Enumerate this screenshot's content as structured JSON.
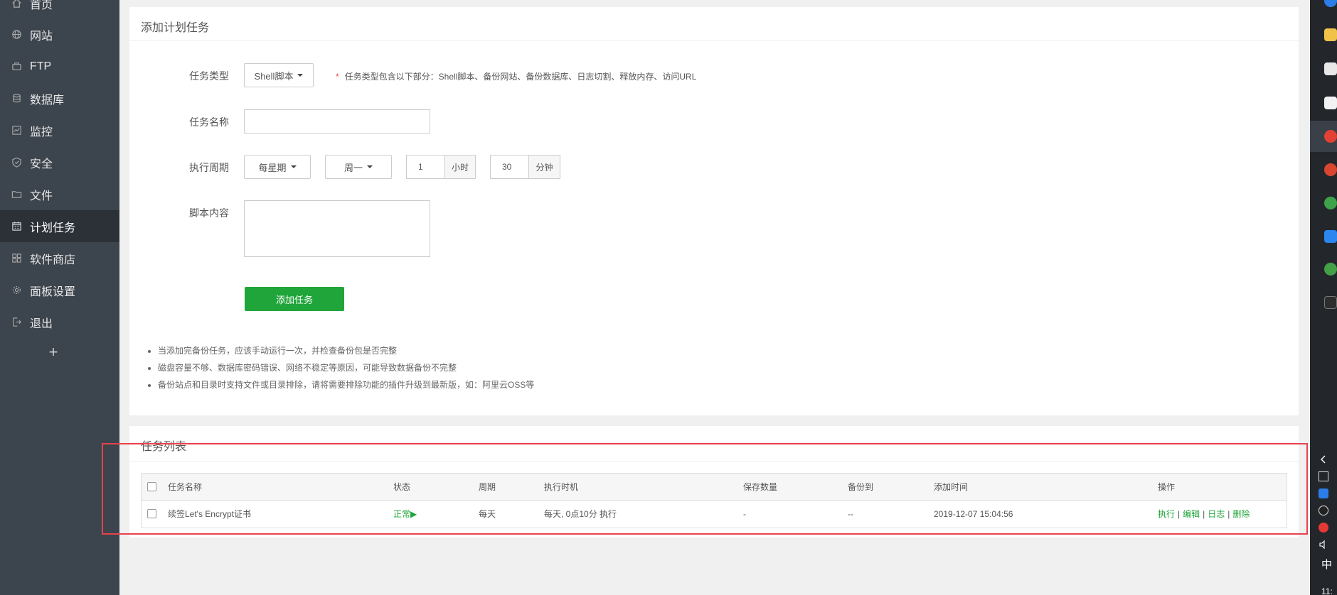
{
  "sidebar": {
    "items": [
      {
        "label": "首页",
        "icon": "home-icon"
      },
      {
        "label": "网站",
        "icon": "globe-icon"
      },
      {
        "label": "FTP",
        "icon": "ftp-icon"
      },
      {
        "label": "数据库",
        "icon": "database-icon"
      },
      {
        "label": "监控",
        "icon": "monitor-icon"
      },
      {
        "label": "安全",
        "icon": "shield-icon"
      },
      {
        "label": "文件",
        "icon": "folder-icon"
      },
      {
        "label": "计划任务",
        "icon": "calendar-icon",
        "active": true
      },
      {
        "label": "软件商店",
        "icon": "grid-icon"
      },
      {
        "label": "面板设置",
        "icon": "gear-icon"
      },
      {
        "label": "退出",
        "icon": "logout-icon"
      }
    ],
    "add_label": "+"
  },
  "add_task": {
    "title": "添加计划任务",
    "type_label": "任务类型",
    "type_value": "Shell脚本",
    "type_hint_star": "*",
    "type_hint": "任务类型包含以下部分：Shell脚本、备份网站、备份数据库、日志切割、释放内存、访问URL",
    "name_label": "任务名称",
    "name_value": "",
    "cycle_label": "执行周期",
    "cycle_value": "每星期",
    "weekday_value": "周一",
    "hour_value": "1",
    "hour_unit": "小时",
    "minute_value": "30",
    "minute_unit": "分钟",
    "script_label": "脚本内容",
    "script_value": "",
    "submit_label": "添加任务",
    "tips": [
      "当添加完备份任务，应该手动运行一次，并检查备份包是否完整",
      "磁盘容量不够、数据库密码错误、网络不稳定等原因，可能导致数据备份不完整",
      "备份站点和目录时支持文件或目录排除，请将需要排除功能的插件升级到最新版，如：阿里云OSS等"
    ]
  },
  "task_list": {
    "title": "任务列表",
    "columns": [
      "任务名称",
      "状态",
      "周期",
      "执行时机",
      "保存数量",
      "备份到",
      "添加时间",
      "操作"
    ],
    "rows": [
      {
        "name": "续签Let's Encrypt证书",
        "status": "正常▶",
        "cycle": "每天",
        "timing": "每天, 0点10分 执行",
        "save_count": "-",
        "backup_to": "--",
        "added": "2019-12-07 15:04:56",
        "actions": [
          "执行",
          "编辑",
          "日志",
          "删除"
        ],
        "action_sep": "|"
      }
    ]
  },
  "taskbar": {
    "ime_label": "中",
    "clock_partial": "11:"
  },
  "colors": {
    "sidebar_bg": "#3c444d",
    "accent_green": "#20a53a",
    "highlight_red": "#e8424c"
  }
}
